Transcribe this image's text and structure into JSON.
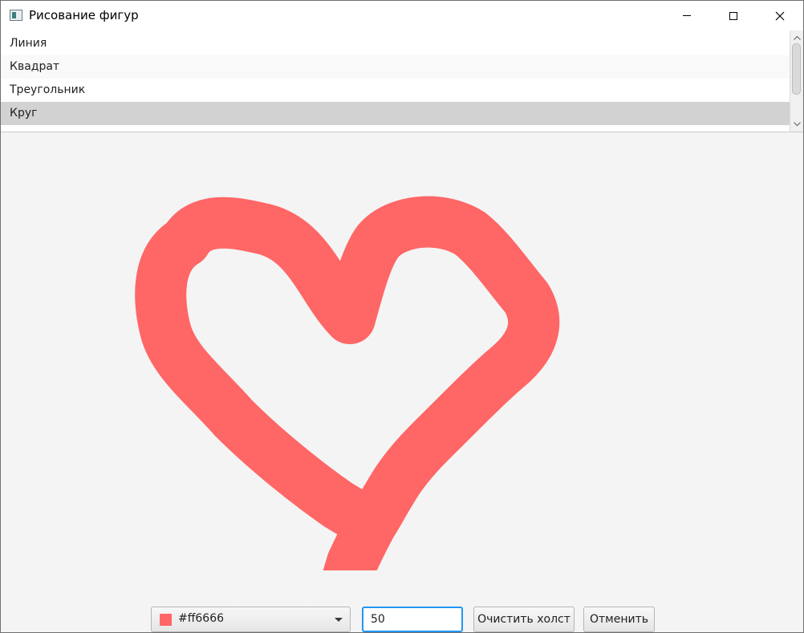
{
  "window": {
    "title": "Рисование фигур"
  },
  "shape_list": {
    "items": [
      {
        "label": "Линия"
      },
      {
        "label": "Квадрат"
      },
      {
        "label": "Треугольник"
      },
      {
        "label": "Круг"
      }
    ],
    "selected_label": "Круг"
  },
  "canvas": {
    "stroke_color": "#ff6666",
    "background_color": "#f4f4f4"
  },
  "toolbar": {
    "color_value": "#ff6666",
    "swatch_color": "#ff6666",
    "size_value": "50",
    "clear_label": "Очистить холст",
    "undo_label": "Отменить"
  },
  "colors": {
    "selection": "#d2d2d2",
    "focus_border": "#2196f3"
  },
  "icons": [
    "app-icon",
    "minimize-icon",
    "maximize-icon",
    "close-icon",
    "chevron-up-icon",
    "chevron-down-icon",
    "dropdown-arrow-icon"
  ]
}
